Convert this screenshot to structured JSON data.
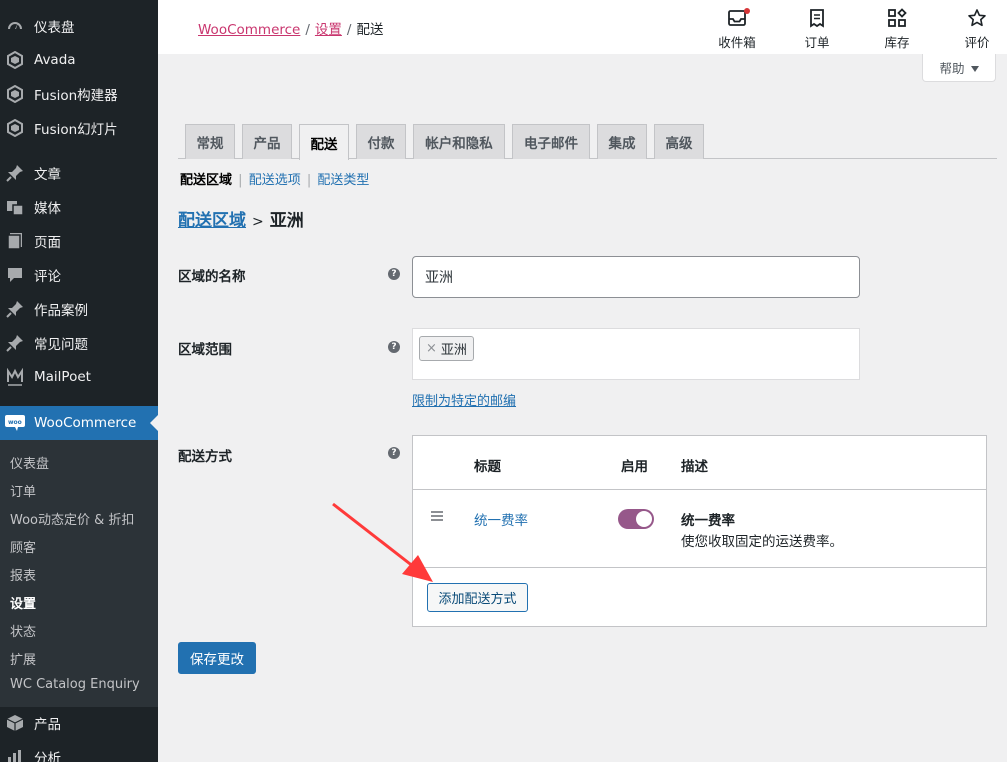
{
  "sidebar": {
    "menu": [
      {
        "label": "仪表盘",
        "icon": "dashboard-icon"
      },
      {
        "label": "Avada",
        "icon": "avada-icon"
      },
      {
        "label": "Fusion构建器",
        "icon": "fusion-builder-icon"
      },
      {
        "label": "Fusion幻灯片",
        "icon": "fusion-slider-icon"
      },
      {
        "label": "文章",
        "icon": "pin-icon"
      },
      {
        "label": "媒体",
        "icon": "media-icon"
      },
      {
        "label": "页面",
        "icon": "page-icon"
      },
      {
        "label": "评论",
        "icon": "comment-icon"
      },
      {
        "label": "作品案例",
        "icon": "pin-icon"
      },
      {
        "label": "常见问题",
        "icon": "pin-icon"
      },
      {
        "label": "MailPoet",
        "icon": "mailpoet-icon"
      },
      {
        "label": "WooCommerce",
        "icon": "woocommerce-icon"
      },
      {
        "label": "产品",
        "icon": "product-box-icon"
      },
      {
        "label": "分析",
        "icon": "analytics-icon"
      }
    ],
    "submenu": [
      {
        "label": "仪表盘"
      },
      {
        "label": "订单"
      },
      {
        "label": "Woo动态定价 & 折扣"
      },
      {
        "label": "顾客"
      },
      {
        "label": "报表"
      },
      {
        "label": "设置"
      },
      {
        "label": "状态"
      },
      {
        "label": "扩展"
      },
      {
        "label": "WC Catalog Enquiry"
      }
    ]
  },
  "topbar": {
    "breadcrumb": {
      "root": "WooCommerce",
      "parent": "设置",
      "current": "配送",
      "sep": "/"
    },
    "actions": [
      {
        "label": "收件箱",
        "icon": "inbox-icon"
      },
      {
        "label": "订单",
        "icon": "orders-icon"
      },
      {
        "label": "库存",
        "icon": "stock-icon"
      },
      {
        "label": "评价",
        "icon": "star-icon"
      }
    ],
    "help": "帮助"
  },
  "tabs": [
    "常规",
    "产品",
    "配送",
    "付款",
    "帐户和隐私",
    "电子邮件",
    "集成",
    "高级"
  ],
  "subnav": {
    "current": "配送区域",
    "links": [
      "配送选项",
      "配送类型"
    ],
    "sep": "|"
  },
  "heading": {
    "link": "配送区域",
    "gt": ">",
    "zone": "亚洲"
  },
  "form": {
    "zone_name_label": "区域的名称",
    "zone_name_value": "亚洲",
    "region_label": "区域范围",
    "region_chip_x": "×",
    "region_chip": "亚洲",
    "postcode_link": "限制为特定的邮编",
    "methods_label": "配送方式",
    "help_glyph": "?"
  },
  "methods_table": {
    "headers": {
      "title": "标题",
      "enabled": "启用",
      "description": "描述"
    },
    "rows": [
      {
        "title": "统一费率",
        "enabled": true,
        "desc_title": "统一费率",
        "desc_text": "使您收取固定的运送费率。"
      }
    ],
    "add_button": "添加配送方式"
  },
  "save_button": "保存更改",
  "colors": {
    "accent": "#2271b1",
    "brand": "#c9356e",
    "toggle": "#96588a",
    "annotation_arrow": "#ff3a3a"
  }
}
